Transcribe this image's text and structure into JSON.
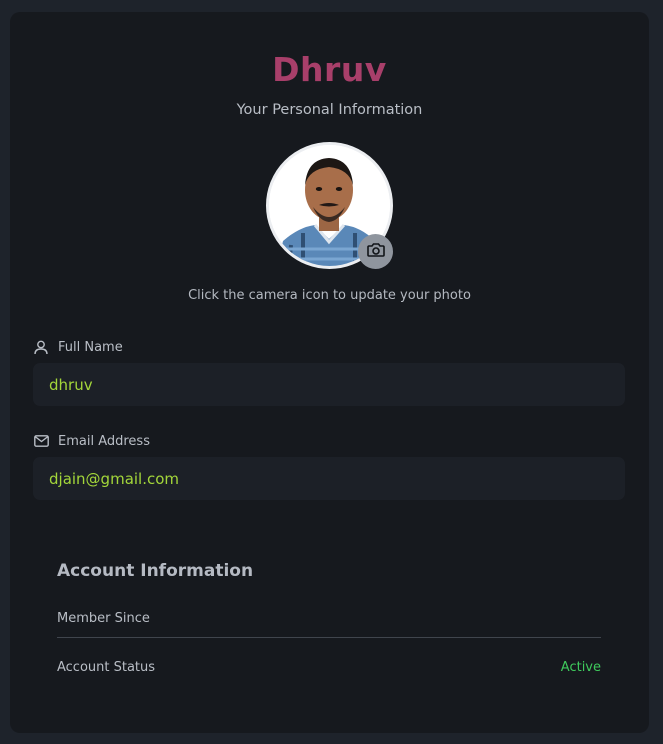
{
  "profile": {
    "name": "Dhruv",
    "subtitle": "Your Personal Information",
    "photo_hint": "Click the camera icon to update your photo"
  },
  "fields": {
    "full_name": {
      "label": "Full Name",
      "value": "dhruv",
      "icon": "user-icon"
    },
    "email": {
      "label": "Email Address",
      "value": "djain@gmail.com",
      "icon": "mail-icon"
    }
  },
  "account": {
    "title": "Account Information",
    "member_since_label": "Member Since",
    "member_since_value": "",
    "status_label": "Account Status",
    "status_value": "Active"
  },
  "colors": {
    "accent_title": "#a83f6a",
    "input_text": "#a3d63a",
    "status_active": "#3ec95c"
  }
}
